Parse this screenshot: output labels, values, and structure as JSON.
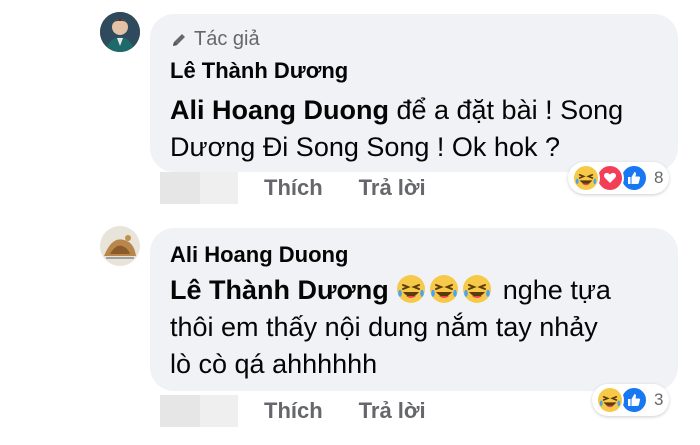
{
  "comments": [
    {
      "author_badge": "Tác giả",
      "author": "Lê Thành Dương",
      "mention": "Ali Hoang Duong",
      "text_line1": " để a đặt bài ! Song",
      "text_line2": "Dương Đi Song Song ! Ok hok ?",
      "reaction_count": "8",
      "reactions": [
        "haha-icon",
        "love-icon",
        "like-icon"
      ],
      "actions": {
        "like": "Thích",
        "reply": "Trả lời"
      }
    },
    {
      "author": "Ali Hoang Duong",
      "mention": "Lê Thành Dương",
      "text_line1": " nghe tựa",
      "text_line2": "thôi em thấy nội dung nắm tay nhảy",
      "text_line3": "lò cò qá ahhhhhh",
      "reaction_count": "3",
      "reactions": [
        "haha-icon",
        "like-icon"
      ],
      "actions": {
        "like": "Thích",
        "reply": "Trả lời"
      }
    }
  ],
  "colors": {
    "bubble": "#f0f2f5",
    "secondary_text": "#65676b",
    "like_blue": "#1877f2",
    "love_red": "#f33e58",
    "haha_yellow": "#f7c948"
  }
}
